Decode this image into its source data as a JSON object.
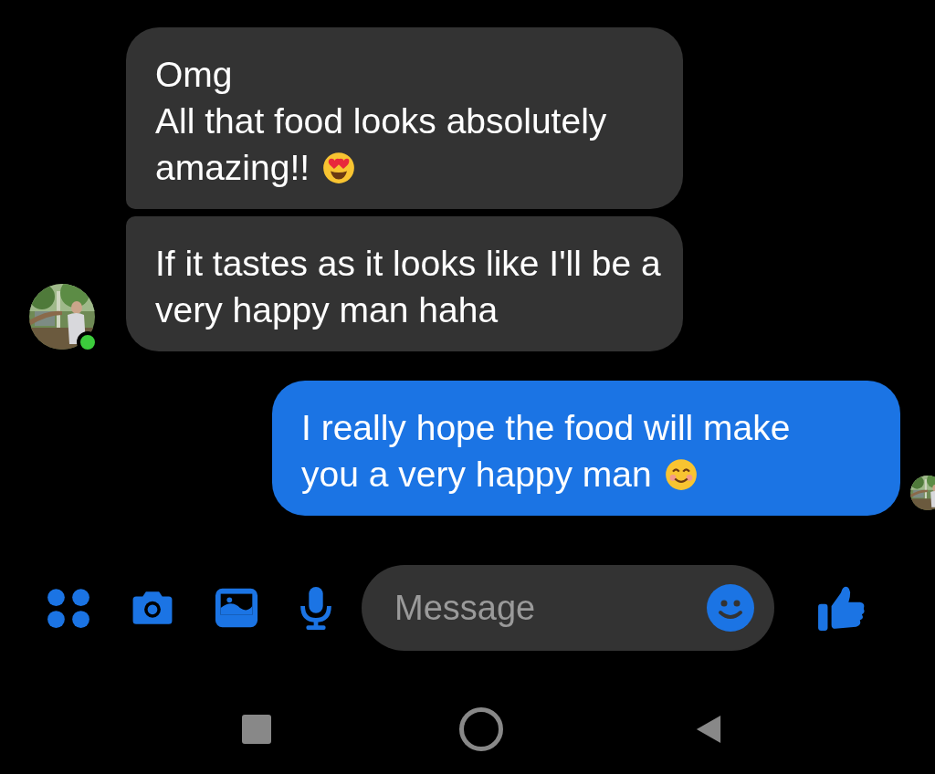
{
  "messages": [
    {
      "kind": "received",
      "lines": [
        "Omg",
        "All that food looks absolutely",
        "amazing!!"
      ],
      "emoji": {
        "kind": "heart_eyes"
      }
    },
    {
      "kind": "received",
      "lines": [
        "If it tastes as it looks like I'll be a",
        "very happy man haha"
      ]
    },
    {
      "kind": "sent",
      "lines": [
        "I really hope the food will make",
        "you a very happy man"
      ],
      "emoji": {
        "kind": "smile"
      }
    }
  ],
  "contact": {
    "online": true
  },
  "composer": {
    "placeholder": "Message"
  }
}
